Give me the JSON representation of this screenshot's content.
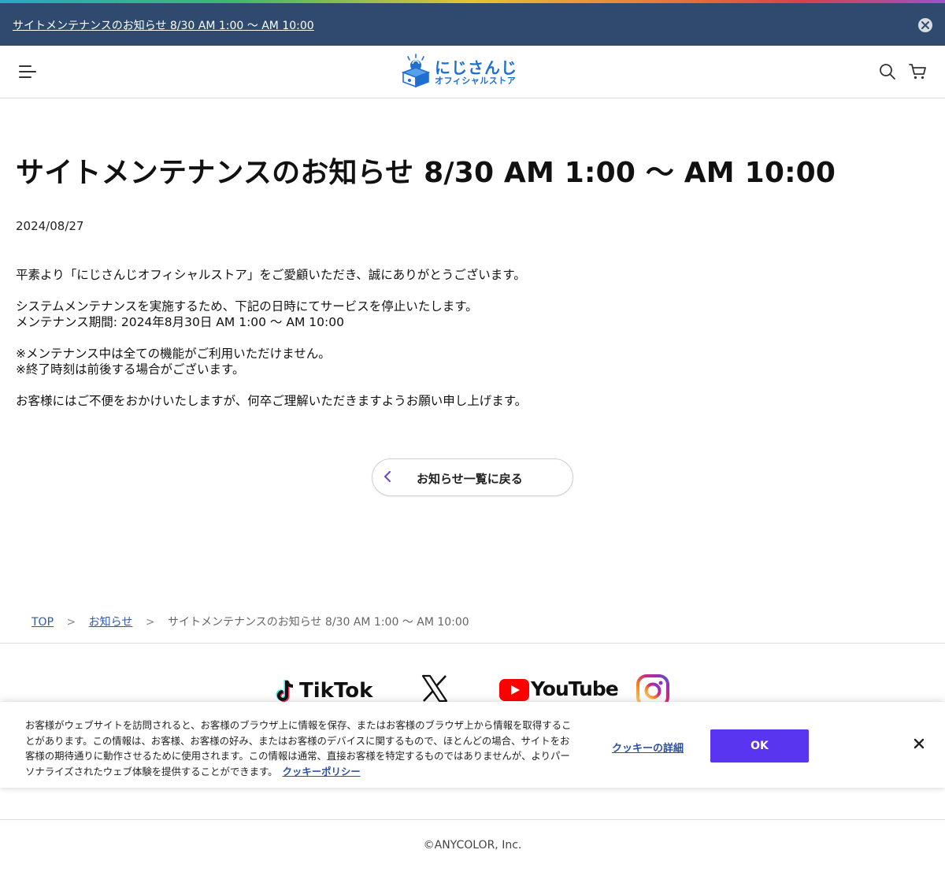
{
  "announcement": {
    "text": "サイトメンテナンスのお知らせ 8/30 AM 1:00 〜 AM 10:00"
  },
  "header": {
    "logo_line1": "にじさんじ",
    "logo_line2": "オフィシャルストア"
  },
  "article": {
    "title": "サイトメンテナンスのお知らせ 8/30 AM 1:00 〜 AM 10:00",
    "date": "2024/08/27",
    "paragraphs": [
      [
        "平素より「にじさんじオフィシャルストア」をご愛顧いただき、誠にありがとうございます。"
      ],
      [
        "システムメンテナンスを実施するため、下記の日時にてサービスを停止いたします。",
        "メンテナンス期間: 2024年8月30日 AM 1:00 〜 AM 10:00"
      ],
      [
        "※メンテナンス中は全ての機能がご利用いただけません。",
        "※終了時刻は前後する場合がございます。"
      ],
      [
        "お客様にはご不便をおかけいたしますが、何卒ご理解いただきますようお願い申し上げます。"
      ]
    ]
  },
  "back_button": {
    "label": "お知らせ一覧に戻る"
  },
  "breadcrumb": {
    "top": "TOP",
    "news": "お知らせ",
    "current": "サイトメンテナンスのお知らせ 8/30 AM 1:00 〜 AM 10:00",
    "separator": ">"
  },
  "social": {
    "tiktok": "TikTok",
    "youtube": "YouTube"
  },
  "cookie_banner": {
    "text": "お客様がウェブサイトを訪問されると、お客様のブラウザ上に情報を保存、またはお客様のブラウザ上から情報を取得することがあります。この情報は、お客様、お客様の好み、またはお客様のデバイスに関するもので、ほとんどの場合、サイトをお客様の期待通りに動作させるために使用されます。この情報は通常、直接お客様を特定するものではありませんが、よりパーソナライズされたウェブ体験を提供することができます。",
    "policy_link": "クッキーポリシー",
    "details_link": "クッキーの詳細",
    "ok_label": "OK"
  },
  "footer": {
    "copyright": "©ANYCOLOR, Inc."
  },
  "colors": {
    "announce_bg": "#2f4a6e",
    "accent_purple": "#5a35f0",
    "link_blue": "#2f5aa8",
    "logo_blue": "#1f6fd1"
  }
}
